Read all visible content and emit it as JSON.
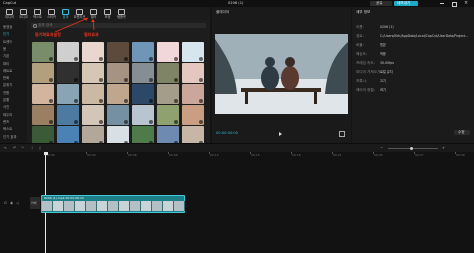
{
  "app": {
    "name": "CapCut",
    "project_title": "0206 (1)"
  },
  "window_controls": [
    "minimize-icon",
    "maximize-icon",
    "close-icon"
  ],
  "top_actions": {
    "share_label": "공유",
    "export_label": "내보내기"
  },
  "toolbar": {
    "tools": [
      {
        "label": "미디어",
        "icon": "media-icon"
      },
      {
        "label": "오디오",
        "icon": "audio-icon"
      },
      {
        "label": "텍스트",
        "icon": "text-icon"
      },
      {
        "label": "스티커",
        "icon": "sticker-icon"
      },
      {
        "label": "효과",
        "icon": "effects-icon"
      },
      {
        "label": "트랜지션",
        "icon": "transition-icon"
      },
      {
        "label": "필터",
        "icon": "filter-icon"
      },
      {
        "label": "조정",
        "icon": "adjust-icon"
      },
      {
        "label": "템플릿",
        "icon": "template-icon"
      }
    ]
  },
  "sidebar": {
    "items": [
      "동영상",
      "인기",
      "트렌드",
      "봄",
      "기본",
      "파티",
      "레트로",
      "만화",
      "분위기",
      "전환",
      "분할",
      "사진",
      "테두리",
      "렌즈",
      "텍스트",
      "인기 효과"
    ]
  },
  "effects_panel": {
    "search_placeholder": "효과 검색",
    "items": [
      {
        "color": "#7a8d6a"
      },
      {
        "color": "#cfcfcf"
      },
      {
        "color": "#e8d6cf"
      },
      {
        "color": "#5c4a3c"
      },
      {
        "color": "#6f96b6"
      },
      {
        "color": "#f1d7d9"
      },
      {
        "color": "#d7e6ee"
      },
      {
        "color": "#b29f7e"
      },
      {
        "color": "#303030"
      },
      {
        "color": "#d6c7b4"
      },
      {
        "color": "#a59482"
      },
      {
        "color": "#858e92"
      },
      {
        "color": "#7e8465"
      },
      {
        "color": "#e4c8c0"
      },
      {
        "color": "#d3b59f"
      },
      {
        "color": "#89a5b5"
      },
      {
        "color": "#cbb9a4"
      },
      {
        "color": "#c1a68e"
      },
      {
        "color": "#2d4866"
      },
      {
        "color": "#a39d8a"
      },
      {
        "color": "#caa79a"
      },
      {
        "color": "#9b7f63"
      },
      {
        "color": "#4d7aa0"
      },
      {
        "color": "#d3c5b8"
      },
      {
        "color": "#7590a3"
      },
      {
        "color": "#b8c4cf"
      },
      {
        "color": "#8fa16e"
      },
      {
        "color": "#c99e82"
      },
      {
        "color": "#3a5a38"
      },
      {
        "color": "#4a82b6"
      },
      {
        "color": "#b3a79a"
      },
      {
        "color": "#d8dfe5"
      },
      {
        "color": "#4f7a4a"
      },
      {
        "color": "#6e8ab0"
      },
      {
        "color": "#c7b6a6"
      }
    ]
  },
  "annotations": {
    "left_note": "동기화효과설정",
    "right_note": "필터효과"
  },
  "player": {
    "title": "플레이어",
    "time": "00:00:00:00"
  },
  "inspector": {
    "title": "세부 정보",
    "fields": [
      {
        "label": "이름:",
        "value": "0206 (1)"
      },
      {
        "label": "경로:",
        "value": "C:/Users/Kkh/AppData/Local/CapCut/UserData/Projects/..."
      },
      {
        "label": "비율:",
        "value": "원본"
      },
      {
        "label": "해상도:",
        "value": "적응"
      },
      {
        "label": "프레임 속도:",
        "value": "30.00fps"
      },
      {
        "label": "미디어 가져오기:",
        "value": "로컬 유지"
      },
      {
        "label": "프록시:",
        "value": "끄기"
      },
      {
        "label": "레이어 정렬:",
        "value": "켜기"
      }
    ],
    "modify_label": "수정"
  },
  "timeline": {
    "ruler": [
      "00:00",
      "00:03",
      "00:06",
      "00:09",
      "00:12",
      "00:15",
      "00:18",
      "00:21",
      "00:24",
      "00:27",
      "00:30"
    ],
    "clip": {
      "label": "0206 (1).mp4  00:00:06:15"
    },
    "cover_label": "커버"
  }
}
